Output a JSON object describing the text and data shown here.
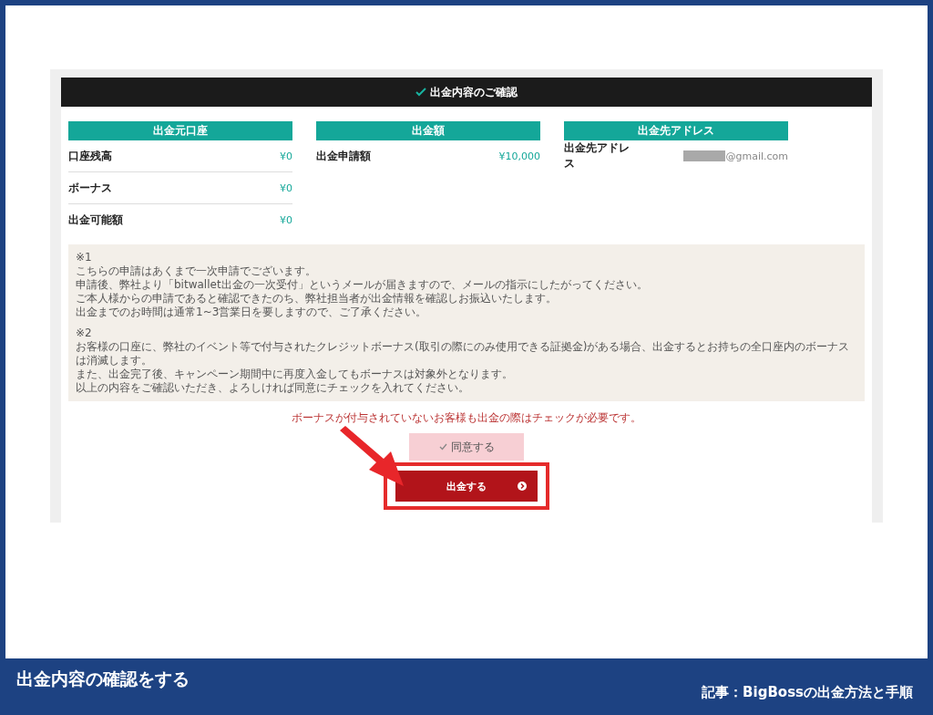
{
  "page": {
    "title": "出金内容のご確認",
    "sections": [
      {
        "heading": "出金元口座",
        "rows": [
          {
            "kind": "amount",
            "label": "口座残高",
            "value": "¥0"
          },
          {
            "kind": "amount",
            "label": "ボーナス",
            "value": "¥0"
          },
          {
            "kind": "amount",
            "label": "出金可能額",
            "value": "¥0"
          }
        ]
      },
      {
        "heading": "出金額",
        "rows": [
          {
            "kind": "amount",
            "label": "出金申請額",
            "value": "¥10,000"
          }
        ]
      },
      {
        "heading": "出金先アドレス",
        "rows": [
          {
            "kind": "email",
            "label": "出金先アドレス",
            "value": "@gmail.com"
          }
        ]
      }
    ],
    "notes": [
      {
        "mark": "※1",
        "lines": [
          "こちらの申請はあくまで一次申請でございます。",
          "申請後、弊社より「bitwallet出金の一次受付」というメールが届きますので、メールの指示にしたがってください。",
          "ご本人様からの申請であると確認できたのち、弊社担当者が出金情報を確認しお振込いたします。",
          "出金までのお時間は通常1~3営業日を要しますので、ご了承ください。"
        ]
      },
      {
        "mark": "※2",
        "lines": [
          "お客様の口座に、弊社のイベント等で付与されたクレジットボーナス(取引の際にのみ使用できる証拠金)がある場合、出金するとお持ちの全口座内のボーナスは消滅します。",
          "また、出金完了後、キャンペーン期間中に再度入金してもボーナスは対象外となります。",
          "以上の内容をご確認いただき、よろしければ同意にチェックを入れてください。"
        ]
      }
    ],
    "warning": "ボーナスが付与されていないお客様も出金の際はチェックが必要です。",
    "agree": {
      "label": "同意する",
      "checked": true
    },
    "submit": {
      "label": "出金する"
    }
  },
  "caption": {
    "title": "出金内容の確認をする",
    "article": "記事：BigBossの出金方法と手順"
  }
}
